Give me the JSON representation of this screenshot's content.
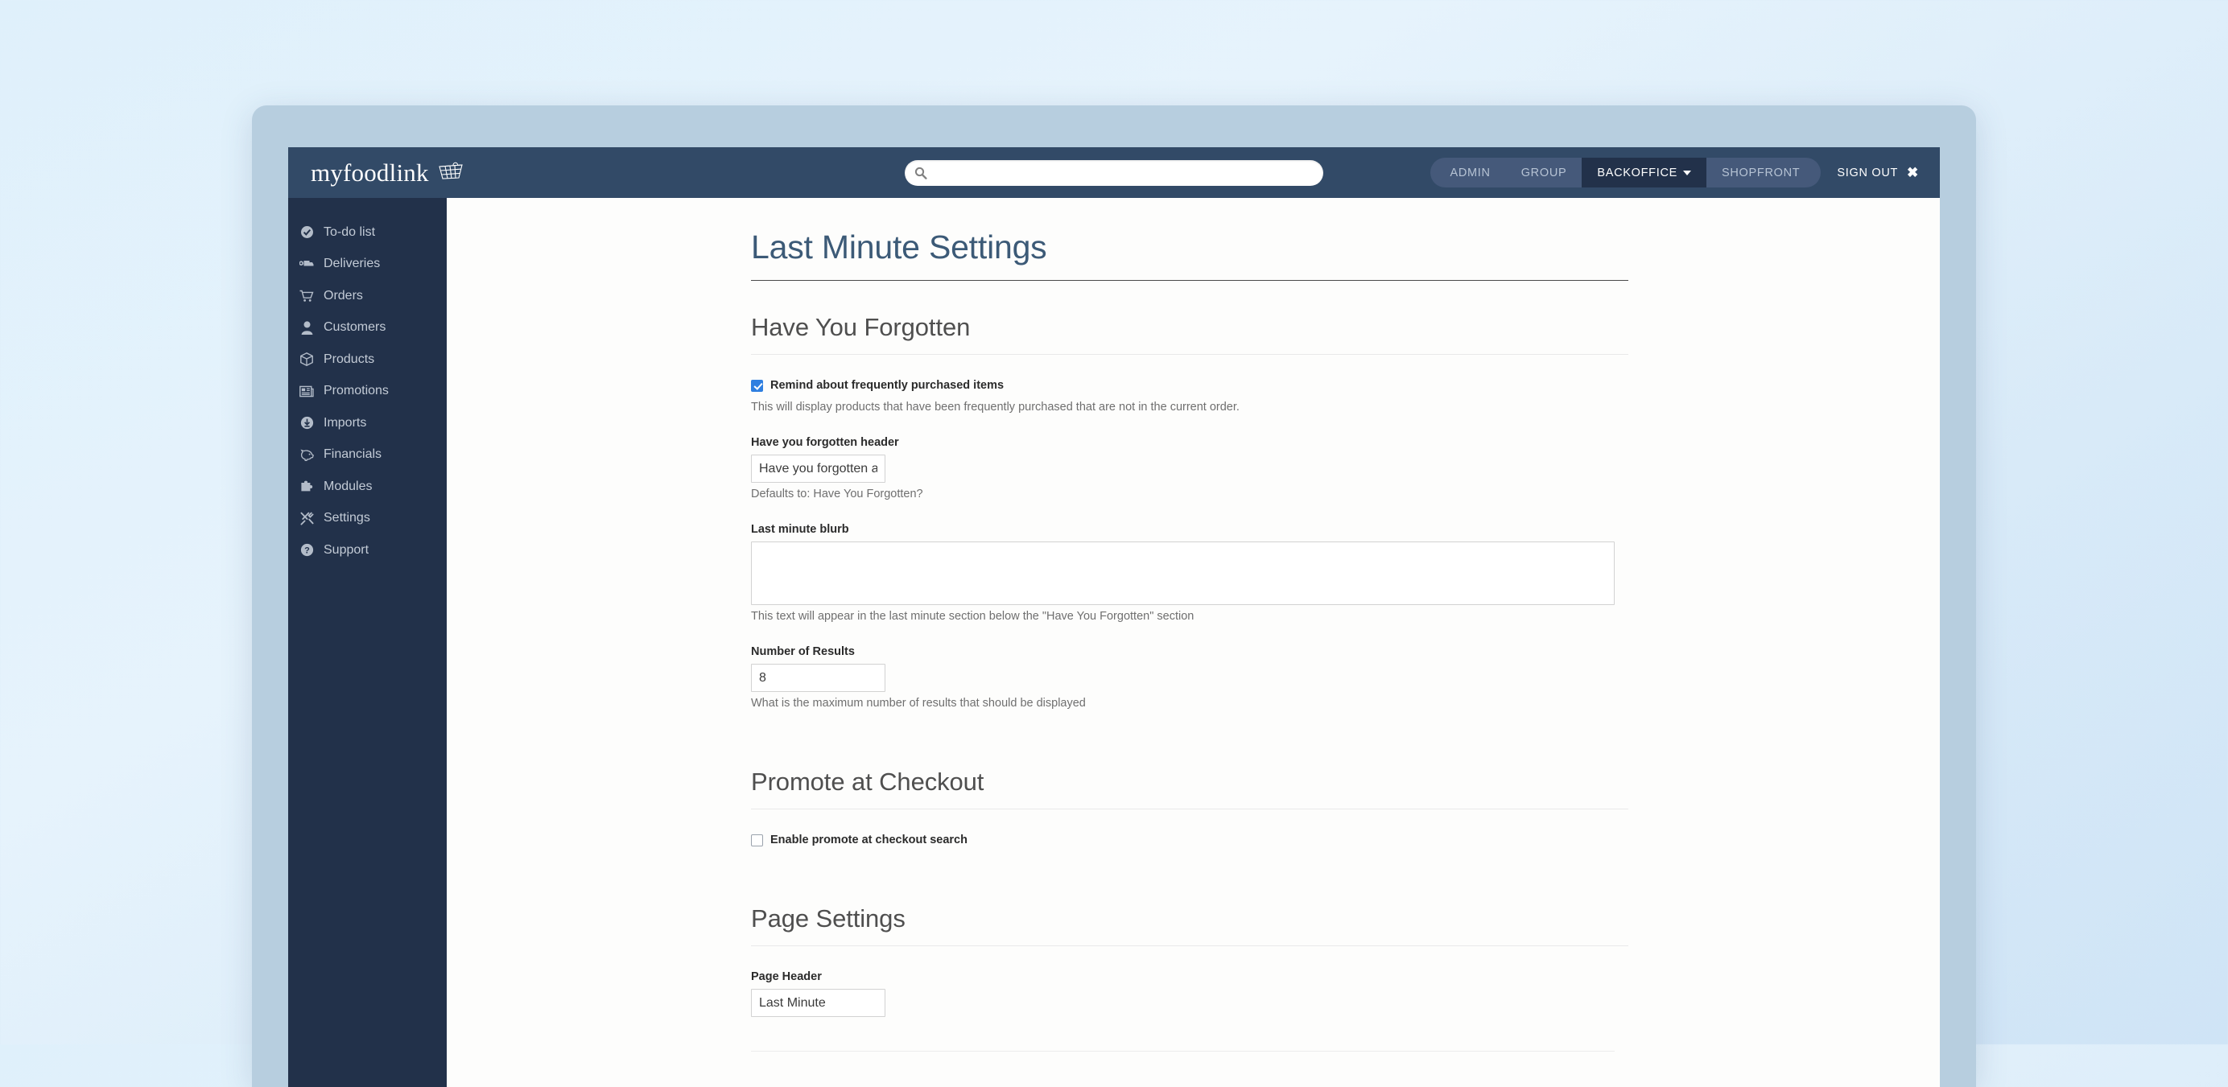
{
  "brand": {
    "name": "myfoodlink",
    "icon": "basket-icon"
  },
  "search": {
    "value": "",
    "placeholder": "",
    "icon": "search-icon"
  },
  "nav": {
    "items": [
      {
        "label": "ADMIN",
        "active": false
      },
      {
        "label": "GROUP",
        "active": false
      },
      {
        "label": "BACKOFFICE",
        "active": true,
        "caret": true
      },
      {
        "label": "SHOPFRONT",
        "active": false
      }
    ],
    "sign_out": "SIGN OUT",
    "sign_out_icon": "close-icon"
  },
  "sidebar": {
    "items": [
      {
        "label": "To-do list",
        "icon": "check-circle-icon"
      },
      {
        "label": "Deliveries",
        "icon": "truck-icon"
      },
      {
        "label": "Orders",
        "icon": "shopping-cart-icon"
      },
      {
        "label": "Customers",
        "icon": "user-icon"
      },
      {
        "label": "Products",
        "icon": "box-icon"
      },
      {
        "label": "Promotions",
        "icon": "newspaper-icon"
      },
      {
        "label": "Imports",
        "icon": "download-circle-icon"
      },
      {
        "label": "Financials",
        "icon": "piggy-bank-icon"
      },
      {
        "label": "Modules",
        "icon": "puzzle-piece-icon"
      },
      {
        "label": "Settings",
        "icon": "tools-icon"
      },
      {
        "label": "Support",
        "icon": "question-circle-icon"
      }
    ]
  },
  "page": {
    "title": "Last Minute Settings"
  },
  "sections": {
    "have_you_forgotten": {
      "heading": "Have You Forgotten",
      "remind_checkbox_label": "Remind about frequently purchased items",
      "remind_checkbox_checked": true,
      "remind_help": "This will display products that have been frequently purchased that are not in the current order.",
      "header_field_label": "Have you forgotten header",
      "header_field_value": "Have you forgotten about",
      "header_field_help": "Defaults to: Have You Forgotten?",
      "blurb_label": "Last minute blurb",
      "blurb_value": "",
      "blurb_help": "This text will appear in the last minute section below the \"Have You Forgotten\" section",
      "results_label": "Number of Results",
      "results_value": "8",
      "results_help": "What is the maximum number of results that should be displayed"
    },
    "promote_at_checkout": {
      "heading": "Promote at Checkout",
      "enable_checkbox_label": "Enable promote at checkout search",
      "enable_checkbox_checked": false
    },
    "page_settings": {
      "heading": "Page Settings",
      "page_header_label": "Page Header",
      "page_header_value": "Last Minute"
    }
  },
  "colors": {
    "navbar": "#324a67",
    "sidebar": "#22314a",
    "nav_pill": "#45597a",
    "nav_active": "#22314a",
    "title": "#3c5a77",
    "checkbox_accent": "#2f7fe0",
    "frame": "#b7cedf"
  }
}
